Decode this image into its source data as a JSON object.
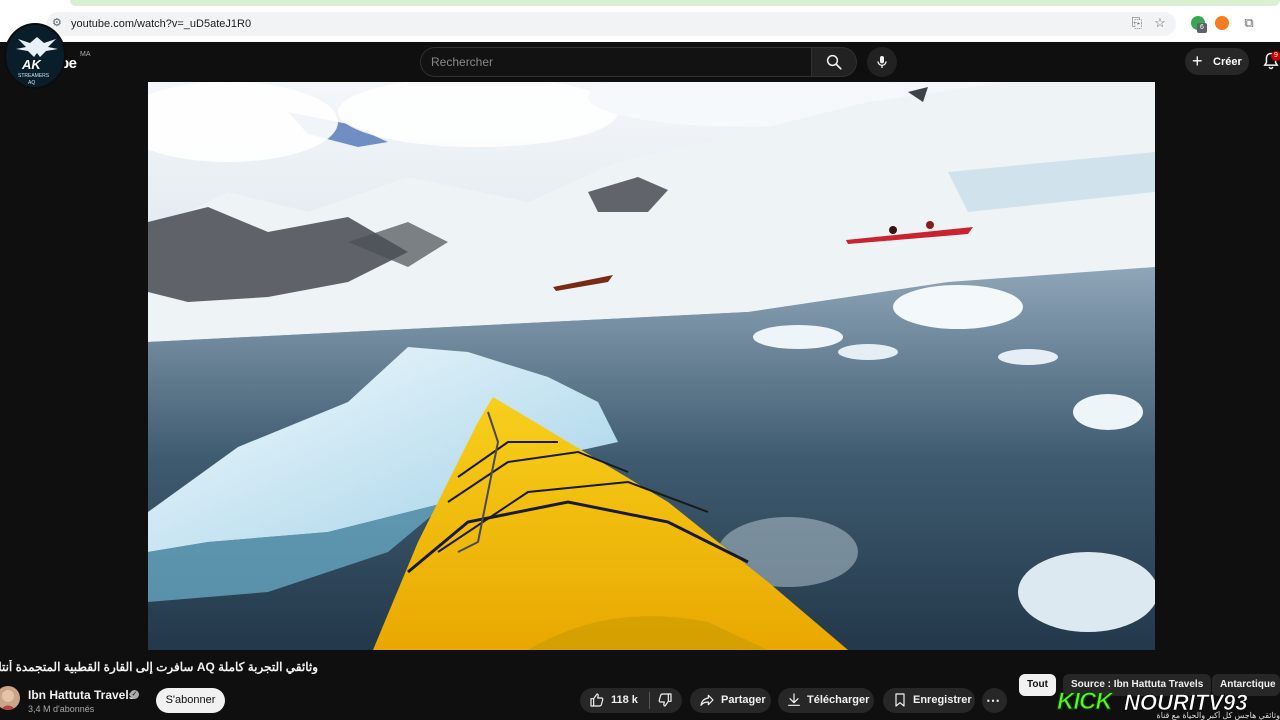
{
  "browser": {
    "url": "youtube.com/watch?v=_uD5ateJ1R0",
    "extension_count": "6"
  },
  "header": {
    "logo_text": "be",
    "region": "MA",
    "search_placeholder": "Rechercher",
    "create_label": "Créer",
    "notification_count": "9"
  },
  "overlay_badge": {
    "title": "AK",
    "subtitle": "STREAMERS",
    "sub2": "AQ"
  },
  "video": {
    "title": "وثائقي التجربة كاملة AQ سافرت إلى القارة القطبية المتجمدة أنتاركتيكا",
    "channel_name": "Ibn Hattuta Travels",
    "subscribers": "3,4 M d'abonnés",
    "subscribe_label": "S'abonner",
    "likes": "118 k",
    "share_label": "Partager",
    "download_label": "Télécharger",
    "save_label": "Enregistrer"
  },
  "chips": [
    "Tout",
    "Source : Ibn Hattuta Travels",
    "Antarctique"
  ],
  "kick_overlay": {
    "brand": "KICK",
    "name": "NOURITV93",
    "ticker": "وثائقي هاجس كل أكبر والحياة مع قناة"
  },
  "colors": {
    "background": "#0f0f0f",
    "kick_green": "#53fc18",
    "kayak_yellow": "#f5c400",
    "pill_bg": "#272727"
  }
}
